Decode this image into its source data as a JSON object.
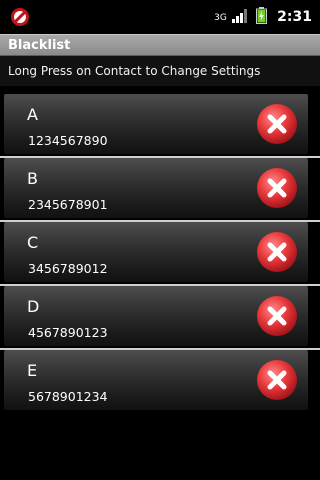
{
  "status_bar": {
    "network_label": "3G",
    "time": "2:31"
  },
  "title_bar": {
    "title": "Blacklist"
  },
  "instruction": "Long Press on Contact to Change Settings",
  "contacts": [
    {
      "name": "A",
      "number": "1234567890"
    },
    {
      "name": "B",
      "number": "2345678901"
    },
    {
      "name": "C",
      "number": "3456789012"
    },
    {
      "name": "D",
      "number": "4567890123"
    },
    {
      "name": "E",
      "number": "5678901234"
    }
  ],
  "icons": {
    "app": "app-logo-icon",
    "network": "network-3g-icon",
    "signal": "signal-bars-icon",
    "battery": "battery-charging-icon",
    "delete": "delete-x-icon"
  },
  "colors": {
    "delete_red": "#e8373a",
    "battery_green": "#6ecf2a",
    "title_bar": "#9a9a9a"
  }
}
